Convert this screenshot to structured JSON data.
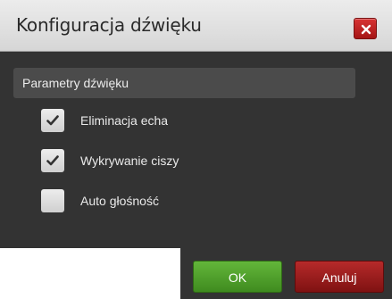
{
  "dialog": {
    "title": "Konfiguracja dźwięku",
    "close_icon": "close-icon"
  },
  "section": {
    "header": "Parametry dźwięku",
    "options": [
      {
        "label": "Eliminacja echa",
        "checked": true
      },
      {
        "label": "Wykrywanie ciszy",
        "checked": true
      },
      {
        "label": "Auto głośność",
        "checked": false
      }
    ]
  },
  "buttons": {
    "ok": "OK",
    "cancel": "Anuluj"
  },
  "colors": {
    "ok": "#4f9e2b",
    "cancel": "#9a1c1c",
    "close": "#c02424",
    "panel": "#333333"
  }
}
